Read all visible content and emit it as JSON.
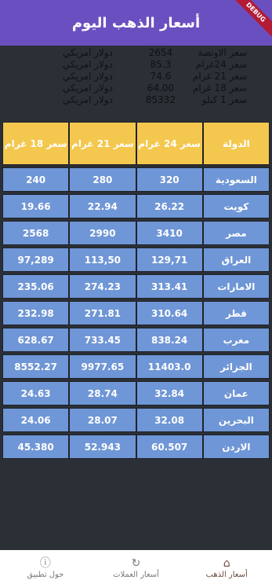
{
  "app": {
    "title": "أسعار الذهب اليوم",
    "debug_label": "DEBUG"
  },
  "summary": [
    {
      "label": "سعر الاونصة",
      "value": "2654",
      "unit": "دولار امريكي"
    },
    {
      "label": "سعر 24غرام",
      "value": "85.3",
      "unit": "دولار امريكي"
    },
    {
      "label": "سعر 21 غرام",
      "value": "74.6",
      "unit": "دولار امريكي"
    },
    {
      "label": "سعر 18 غرام",
      "value": "64.00",
      "unit": "دولار امريكي"
    },
    {
      "label": "سعر 1 كيلو",
      "value": "85332",
      "unit": "دولار امريكي"
    }
  ],
  "table": {
    "headers": [
      "الدولة",
      "سعر 24 غرام",
      "سعر 21 غرام",
      "سعر 18 غرام"
    ],
    "rows": [
      [
        "السعودية",
        "320",
        "280",
        "240"
      ],
      [
        "كويت",
        "26.22",
        "22.94",
        "19.66"
      ],
      [
        "مصر",
        "3410",
        "2990",
        "2568"
      ],
      [
        "العراق",
        "129,71",
        "113,50",
        "97,289"
      ],
      [
        "الامارات",
        "313.41",
        "274.23",
        "235.06"
      ],
      [
        "قطر",
        "310.64",
        "271.81",
        "232.98"
      ],
      [
        "مغرب",
        "838.24",
        "733.45",
        "628.67"
      ],
      [
        "الجزائر",
        "11403.0",
        "9977.65",
        "8552.27"
      ],
      [
        "عمان",
        "32.84",
        "28.74",
        "24.63"
      ],
      [
        "البحرين",
        "32.08",
        "28.07",
        "24.06"
      ],
      [
        "الاردن",
        "60.507",
        "52.943",
        "45.380"
      ]
    ]
  },
  "bottom_nav": [
    {
      "label": "أسعار الذهب",
      "icon": "home-icon",
      "active": true
    },
    {
      "label": "أسعار العملات",
      "icon": "currency-exchange-icon",
      "active": false
    },
    {
      "label": "حول تطبيق",
      "icon": "help-icon",
      "active": false
    }
  ],
  "colors": {
    "appbar": "#6a4fc0",
    "header_cell": "#f4c84e",
    "data_cell": "#6f96d6",
    "background": "#2b2f36"
  }
}
